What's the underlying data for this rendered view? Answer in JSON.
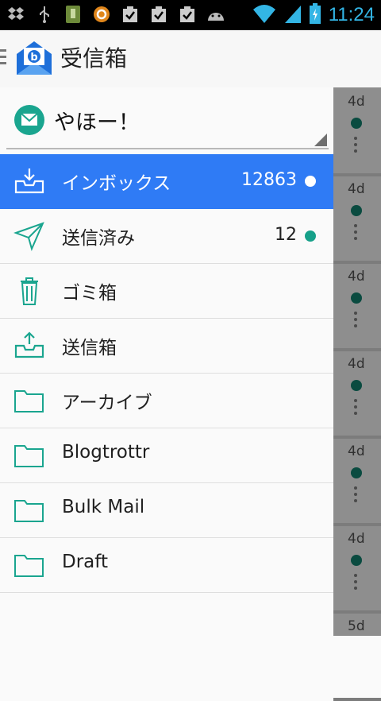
{
  "status_bar": {
    "time": "11:24",
    "icons": [
      "dropbox-icon",
      "usb-icon",
      "sd-card-icon",
      "orange-app-icon",
      "task-check-icon",
      "task-check-icon",
      "task-check-icon",
      "android-icon",
      "wifi-icon",
      "signal-icon",
      "battery-icon"
    ]
  },
  "app_bar": {
    "title": "受信箱"
  },
  "account": {
    "name": "やほー！"
  },
  "folders": [
    {
      "label": "インボックス",
      "count": "12863",
      "icon": "inbox-icon",
      "active": true
    },
    {
      "label": "送信済み",
      "count": "12",
      "icon": "send-icon"
    },
    {
      "label": "ゴミ箱",
      "icon": "trash-icon"
    },
    {
      "label": "送信箱",
      "icon": "outbox-icon"
    },
    {
      "label": "アーカイブ",
      "icon": "folder-icon"
    },
    {
      "label": "Blogtrottr",
      "icon": "folder-icon"
    },
    {
      "label": "Bulk Mail",
      "icon": "folder-icon"
    },
    {
      "label": "Draft",
      "icon": "folder-icon"
    }
  ],
  "background_list": {
    "ages": [
      "4d",
      "4d",
      "4d",
      "4d",
      "4d",
      "4d",
      "5d"
    ]
  },
  "colors": {
    "accent": "#2f7bf5",
    "teal": "#1aa58f",
    "clock": "#33b5e5"
  }
}
